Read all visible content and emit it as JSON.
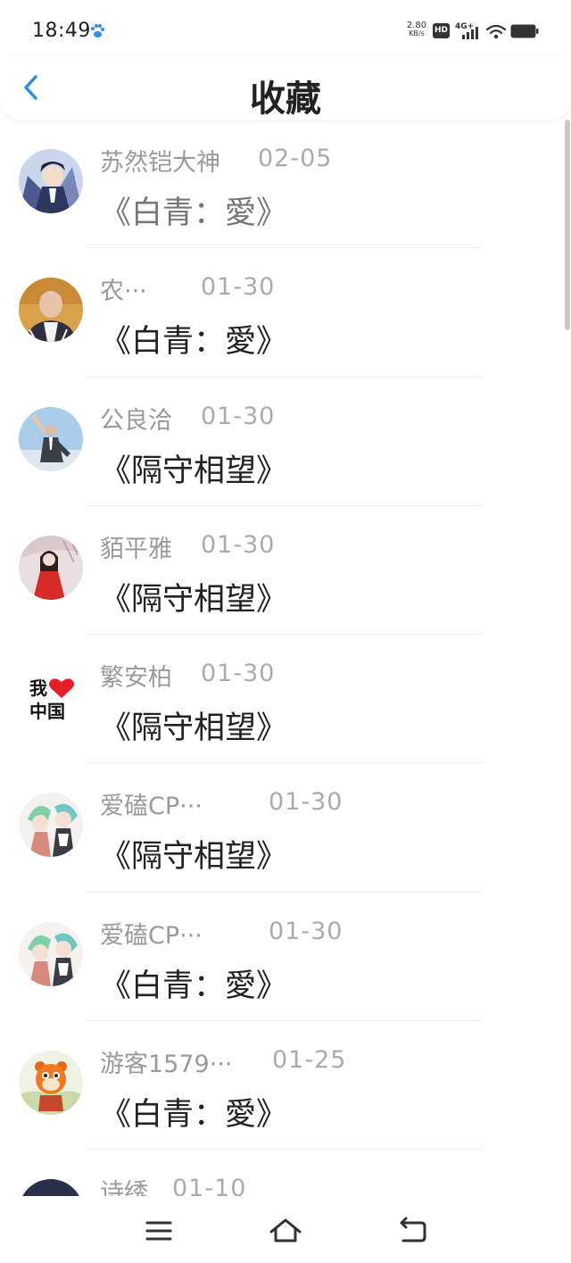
{
  "status_bar": {
    "time": "18:49",
    "net_speed": "2.80",
    "net_unit": "KB/s",
    "hd": "HD",
    "signal": "4G+"
  },
  "header": {
    "title": "收藏",
    "back_icon": "chevron-left-icon"
  },
  "favorites": [
    {
      "name": "苏然铠大神",
      "date": "02-05",
      "title": "《白青：愛》",
      "avatar": "anime-boy"
    },
    {
      "name": "农···",
      "date": "01-30",
      "title": "《白青：愛》",
      "avatar": "man-portrait"
    },
    {
      "name": "公良洽",
      "date": "01-30",
      "title": "《隔守相望》",
      "avatar": "sky-figure"
    },
    {
      "name": "貊平雅",
      "date": "01-30",
      "title": "《隔守相望》",
      "avatar": "girl-red-dress"
    },
    {
      "name": "繁安柏",
      "date": "01-30",
      "title": "《隔守相望》",
      "avatar": "love-china-logo"
    },
    {
      "name": "爱磕CP···",
      "date": "01-30",
      "title": "《隔守相望》",
      "avatar": "anime-couple"
    },
    {
      "name": "爱磕CP···",
      "date": "01-30",
      "title": "《白青：愛》",
      "avatar": "anime-couple"
    },
    {
      "name": "游客1579···",
      "date": "01-25",
      "title": "《白青：愛》",
      "avatar": "cartoon-tiger"
    },
    {
      "name": "诗绣",
      "date": "01-10",
      "title": "",
      "avatar": "dark-portrait"
    }
  ],
  "avatar_text": {
    "love_china_top": "我",
    "love_china_bottom": "中国"
  },
  "nav": {
    "menu_icon": "menu-icon",
    "home_icon": "home-icon",
    "back_icon": "back-icon"
  },
  "colors": {
    "accent": "#2b8fe0",
    "name_gray": "#9a9a9a",
    "title_dark": "#222222"
  }
}
